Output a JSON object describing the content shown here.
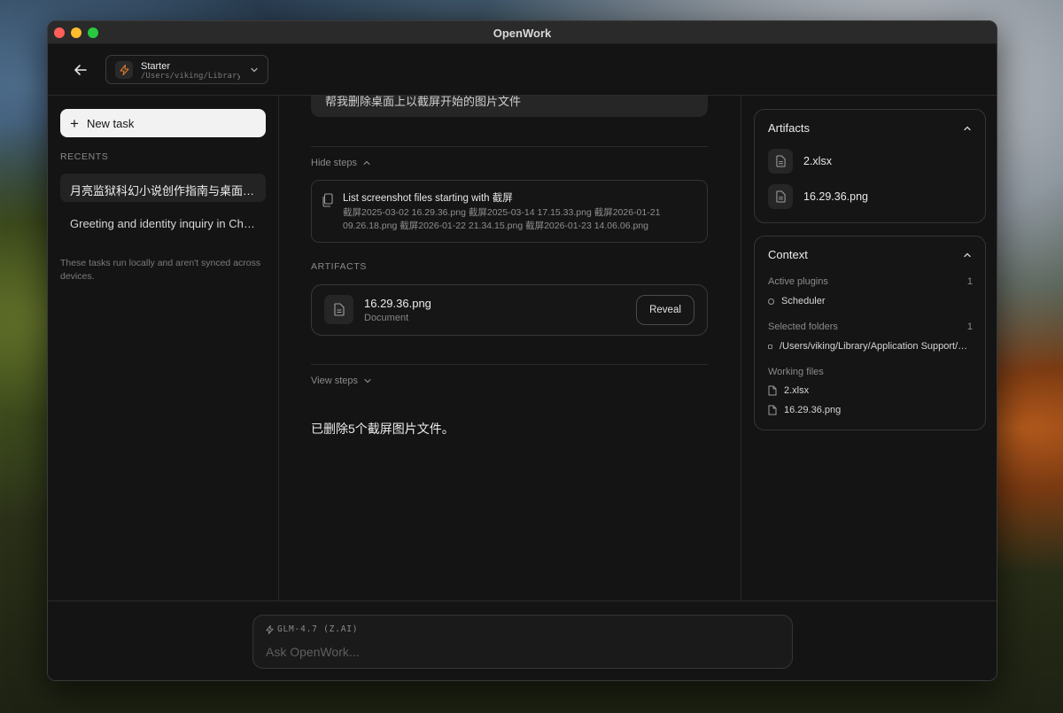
{
  "window": {
    "title": "OpenWork"
  },
  "workspace": {
    "name": "Starter",
    "path": "/Users/viking/Library/Application Support"
  },
  "sidebar": {
    "new_task_label": "New task",
    "recents_label": "RECENTS",
    "recents": [
      {
        "label": "月亮监狱科幻小说创作指南与桌面截屏清理",
        "active": true
      },
      {
        "label": "Greeting and identity inquiry in Chinese",
        "active": false
      }
    ],
    "note": "These tasks run locally and aren't synced across devices."
  },
  "conversation": {
    "user_message": "帮我删除桌面上以截屏开始的图片文件",
    "hide_steps_label": "Hide steps",
    "step": {
      "title": "List screenshot files starting with 截屏",
      "detail": "截屏2025-03-02 16.29.36.png 截屏2025-03-14 17.15.33.png 截屏2026-01-21 09.26.18.png 截屏2026-01-22 21.34.15.png 截屏2026-01-23 14.06.06.png"
    },
    "artifacts_label": "ARTIFACTS",
    "artifact": {
      "name": "16.29.36.png",
      "type": "Document",
      "reveal_label": "Reveal"
    },
    "view_steps_label": "View steps",
    "assistant_message": "已删除5个截屏图片文件。"
  },
  "right_panel": {
    "artifacts": {
      "title": "Artifacts",
      "items": [
        "2.xlsx",
        "16.29.36.png"
      ]
    },
    "context": {
      "title": "Context",
      "active_plugins_label": "Active plugins",
      "active_plugins_count": "1",
      "plugins": [
        "Scheduler"
      ],
      "selected_folders_label": "Selected folders",
      "selected_folders_count": "1",
      "folders": [
        "/Users/viking/Library/Application Support/OpenWork"
      ],
      "working_files_label": "Working files",
      "working_files": [
        "2.xlsx",
        "16.29.36.png"
      ]
    }
  },
  "composer": {
    "model_label": "GLM-4.7 (Z.AI)",
    "placeholder": "Ask OpenWork..."
  },
  "colors": {
    "window_bg": "#141414",
    "panel_border": "#353535",
    "button_light": "#f2f2f2"
  }
}
